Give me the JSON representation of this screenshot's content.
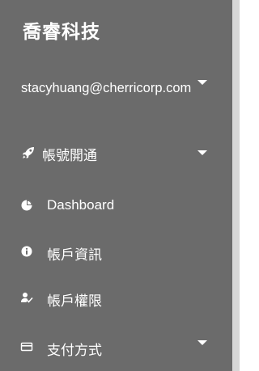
{
  "brand": {
    "title": "喬睿科技"
  },
  "user": {
    "email": "stacyhuang@cherricorp.com"
  },
  "menu": {
    "account_opening": {
      "label": "帳號開通",
      "icon": "rocket-icon"
    },
    "dashboard": {
      "label": "Dashboard",
      "icon": "dashboard-pie-icon"
    },
    "account_info": {
      "label": "帳戶資訊",
      "icon": "info-icon"
    },
    "account_permissions": {
      "label": "帳戶權限",
      "icon": "user-check-icon"
    },
    "payment_methods": {
      "label": "支付方式",
      "icon": "credit-card-icon"
    }
  },
  "colors": {
    "sidebar_bg": "#6b6b6b",
    "text": "#ffffff",
    "scroll_rail": "#d7d7d7"
  }
}
